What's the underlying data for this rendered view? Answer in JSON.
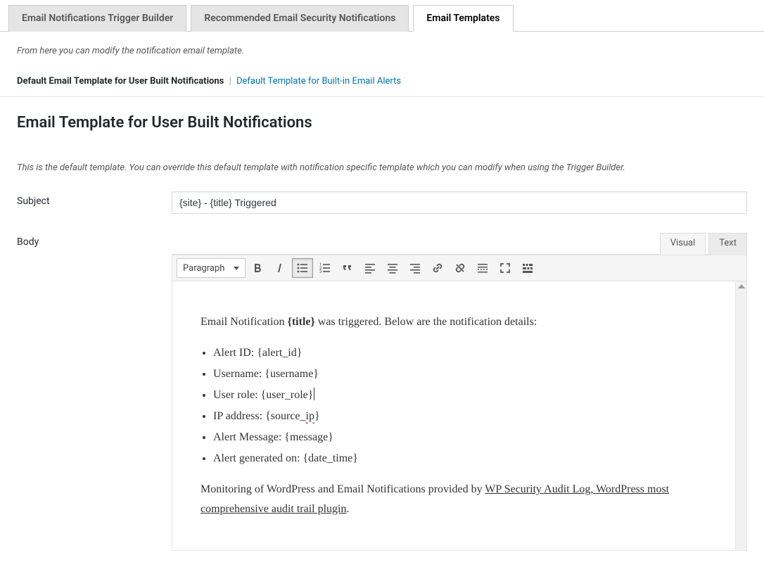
{
  "tabs": [
    {
      "label": "Email Notifications Trigger Builder"
    },
    {
      "label": "Recommended Email Security Notifications"
    },
    {
      "label": "Email Templates"
    }
  ],
  "intro": "From here you can modify the notification email template.",
  "subnav": {
    "current": "Default Email Template for User Built Notifications",
    "sep": "|",
    "link": "Default Template for Built-in Email Alerts"
  },
  "page_title": "Email Template for User Built Notifications",
  "desc": "This is the default template. You can override this default template with notification specific template which you can modify when using the Trigger Builder.",
  "labels": {
    "subject": "Subject",
    "body": "Body"
  },
  "subject_value": "{site} - {title} Triggered",
  "editor_tabs": {
    "visual": "Visual",
    "text": "Text"
  },
  "format_selector": "Paragraph",
  "body_content": {
    "intro_pre": "Email Notification ",
    "intro_title": "{title}",
    "intro_post": " was triggered. Below are the notification details:",
    "items": [
      {
        "text": "Alert ID: {alert_id}"
      },
      {
        "text": "Username: {username}"
      },
      {
        "text": "User role: {user_role}",
        "cursor": true
      },
      {
        "pre": "IP address: {source_",
        "wavy": "ip",
        "post": "}"
      },
      {
        "text": "Alert Message: {message}"
      },
      {
        "text": "Alert generated on: {date_time}"
      }
    ],
    "footer_pre": "Monitoring of WordPress and Email Notifications provided by ",
    "footer_link": "WP Security Audit Log, WordPress most comprehensive audit trail plugin",
    "footer_post": "."
  }
}
